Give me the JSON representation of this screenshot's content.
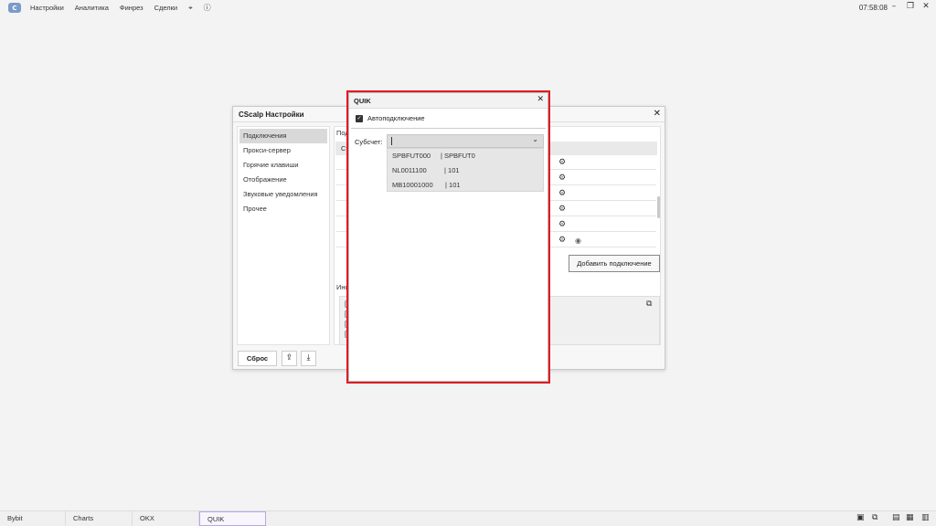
{
  "app": {
    "logo_text": "C",
    "clock": "07:58:08"
  },
  "menubar": {
    "items": [
      "Настройки",
      "Аналитика",
      "Финрез",
      "Сделки"
    ],
    "icons": [
      "pin-off-icon",
      "help-icon"
    ],
    "window_controls": [
      "minimize-icon",
      "restore-icon",
      "close-icon"
    ]
  },
  "settings": {
    "title": "CScalp Настройки",
    "nav": [
      "Подключения",
      "Прокси-сервер",
      "Горячие клавиши",
      "Отображение",
      "Звуковые уведомления",
      "Прочее"
    ],
    "active_nav": "Подключения",
    "section_label": "Подк",
    "table_header": "Ст",
    "add_button": "Добавить подключение",
    "info_label": "Инф",
    "log_lines": [
      "[1",
      "[1",
      "[1",
      "[1"
    ],
    "reset_button": "Сброс"
  },
  "quik": {
    "title": "QUIK",
    "auto_connect_label": "Автоподключение",
    "auto_connect_checked": true,
    "subaccount_label": "Субсчет:",
    "subaccount_value": "",
    "options": [
      {
        "name": "SPBFUT000",
        "account": "| SPBFUT0"
      },
      {
        "name": "NL0011100",
        "account": "| 101"
      },
      {
        "name": "MB10001000",
        "account": "| 101"
      }
    ],
    "highlight_color": "#e01b24"
  },
  "taskbar": {
    "tabs": [
      "Bybit",
      "Charts",
      "OKX",
      "QUIK"
    ],
    "active_tab": "QUIK"
  }
}
